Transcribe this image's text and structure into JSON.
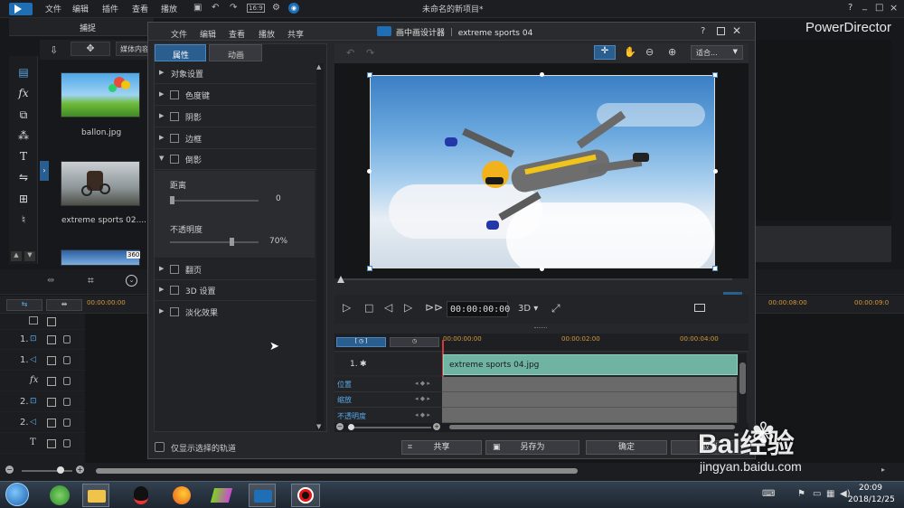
{
  "app": {
    "menu": [
      "文件",
      "编辑",
      "插件",
      "查看",
      "播放"
    ],
    "project_title": "未命名的新项目*",
    "brand": "PowerDirector",
    "win_controls": [
      "?",
      "_",
      "□",
      "×"
    ]
  },
  "left_panel": {
    "tab_capture": "捕捉",
    "media_content_button": "媒体内容",
    "media": [
      {
        "name": "ballon.jpg"
      },
      {
        "name": "extreme sports 02...."
      },
      {
        "badge": "360"
      }
    ]
  },
  "timeline": {
    "ruler_left": "00:00:00:00",
    "ruler_right1": "00:00:08:00",
    "ruler_right2": "00:00:09:0",
    "tracks": [
      {
        "label": "1."
      },
      {
        "label": "1."
      },
      {
        "label": "fx"
      },
      {
        "label": "2."
      },
      {
        "label": "2."
      },
      {
        "label": "T"
      }
    ]
  },
  "dialog": {
    "menu": [
      "文件",
      "编辑",
      "查看",
      "播放",
      "共享"
    ],
    "title": "画中画设计器 ｜ extreme sports 04",
    "help": "?",
    "tabs": [
      "属性",
      "动画"
    ],
    "fit_dropdown": "适合...",
    "sections": [
      {
        "label": "对象设置",
        "checkbox": false
      },
      {
        "label": "色度键",
        "checkbox": true
      },
      {
        "label": "阴影",
        "checkbox": true
      },
      {
        "label": "边框",
        "checkbox": true
      },
      {
        "label": "倒影",
        "checkbox": true,
        "expanded": true
      }
    ],
    "reflection": {
      "distance_label": "距离",
      "distance_value": "0",
      "distance_level": 0,
      "opacity_label": "不透明度",
      "opacity_value": "70%",
      "opacity_level": 0.7
    },
    "sections_after": [
      {
        "label": "翻页"
      },
      {
        "label": "3D 设置"
      },
      {
        "label": "淡化效果"
      }
    ],
    "timecode": "00:00:00:00",
    "mode_3d": "3D ▾",
    "kf_ruler": [
      "00:00:00:00",
      "00:00:02:00",
      "00:00:04:00"
    ],
    "track_label": "1.",
    "clip_name": "extreme sports 04.jpg",
    "kf_rows": [
      "位置",
      "缩放",
      "不透明度"
    ],
    "show_selected": "仅显示选择的轨道",
    "buttons": {
      "share": "共享",
      "save_as": "另存为",
      "ok": "确定",
      "cancel": "取消"
    }
  },
  "watermark": {
    "text": "Bai经验",
    "url": "jingyan.baidu.com"
  },
  "taskbar": {
    "time": "20:09",
    "date": "2018/12/25"
  },
  "colors": {
    "accent": "#5aa9e6",
    "clip": "#6fb3a3",
    "playhead": "#d23b3b"
  }
}
